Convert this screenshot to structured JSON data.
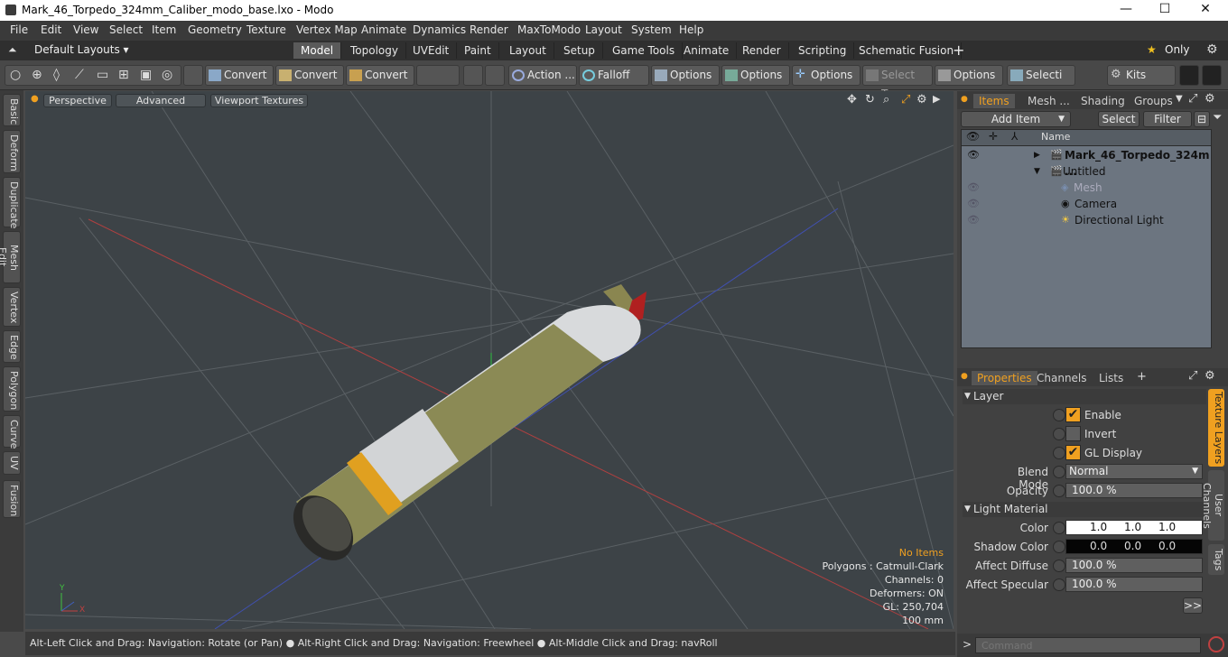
{
  "window": {
    "title": "Mark_46_Torpedo_324mm_Caliber_modo_base.lxo - Modo",
    "min": "—",
    "max": "☐",
    "close": "✕"
  },
  "menubar": [
    "File",
    "Edit",
    "View",
    "Select",
    "Item",
    "Geometry",
    "Texture",
    "Vertex Map",
    "Animate",
    "Dynamics",
    "Render",
    "MaxToModo",
    "Layout",
    "System",
    "Help"
  ],
  "layoutbar": {
    "layouts_label": "Default Layouts ▾",
    "tabs": [
      "Model",
      "Topology",
      "UVEdit",
      "Paint",
      "Layout",
      "Setup",
      "Game Tools",
      "Animate",
      "Render",
      "Scripting",
      "Schematic Fusion"
    ],
    "active_tab": "Model",
    "add": "+",
    "only": "Only"
  },
  "toolbar": {
    "convert1": "Convert",
    "convert2": "Convert",
    "convert3": "Convert",
    "action": "Action ...",
    "falloff": "Falloff",
    "options1": "Options",
    "options2": "Options",
    "options3": "Options",
    "select_t": "Select T...",
    "options4": "Options",
    "selecti": "Selecti ...",
    "kits": "Kits"
  },
  "left_tabs": [
    "Basic",
    "Deform",
    "Duplicate",
    "Mesh Edit",
    "Vertex",
    "Edge",
    "Polygon",
    "Curve",
    "UV",
    "Fusion"
  ],
  "viewport": {
    "buttons": [
      "Perspective",
      "Advanced",
      "Viewport Textures"
    ],
    "info": {
      "no_items": "No Items",
      "polygons": "Polygons : Catmull-Clark",
      "channels": "Channels: 0",
      "deformers": "Deformers: ON",
      "gl": "GL: 250,704",
      "scale": "100 mm"
    },
    "axis_y": "Y",
    "axis_x": "X",
    "axis_z": "Z"
  },
  "statusbar": "Alt-Left Click and Drag: Navigation: Rotate (or Pan) ● Alt-Right Click and Drag: Navigation: Freewheel ● Alt-Middle Click and Drag: navRoll",
  "items_panel": {
    "tabs": [
      "Items",
      "Mesh ...",
      "Shading",
      "Groups"
    ],
    "add_item": "Add Item",
    "select": "Select",
    "filter": "Filter",
    "name_col": "Name",
    "rows": [
      {
        "label": "Mark_46_Torpedo_324m ..."
      },
      {
        "label": "Untitled"
      },
      {
        "label": "Mesh"
      },
      {
        "label": "Camera"
      },
      {
        "label": "Directional Light"
      }
    ]
  },
  "properties": {
    "tabs": [
      "Properties",
      "Channels",
      "Lists"
    ],
    "add": "+",
    "layer_section": "Layer",
    "enable": "Enable",
    "invert": "Invert",
    "gl_display": "GL Display",
    "blend_mode_label": "Blend Mode",
    "blend_mode": "Normal",
    "opacity_label": "Opacity",
    "opacity": "100.0 %",
    "light_material_section": "Light Material",
    "color_label": "Color",
    "color": [
      "1.0",
      "1.0",
      "1.0"
    ],
    "shadow_color_label": "Shadow Color",
    "shadow_color": [
      "0.0",
      "0.0",
      "0.0"
    ],
    "affect_diffuse_label": "Affect Diffuse",
    "affect_diffuse": "100.0 %",
    "affect_specular_label": "Affect Specular",
    "affect_specular": "100.0 %",
    "expand": ">>",
    "side_tabs": [
      "Texture Layers",
      "User Channels",
      "Tags"
    ]
  },
  "command": {
    "placeholder": "Command"
  }
}
